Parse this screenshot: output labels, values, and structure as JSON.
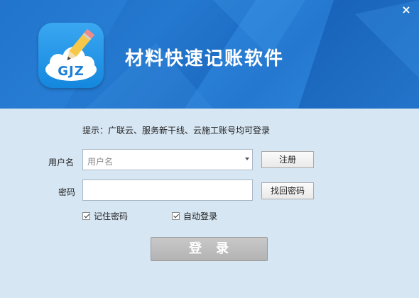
{
  "header": {
    "title": "材料快速记账软件",
    "close_icon": "×",
    "logo_text": "GJZ"
  },
  "form": {
    "tip": "提示：广联云、服务新干线、云施工账号均可登录",
    "username_label": "用户名",
    "username_placeholder": "用户名",
    "password_label": "密码",
    "register_label": "注册",
    "find_password_label": "找回密码",
    "remember_label": "记住密码",
    "auto_login_label": "自动登录",
    "remember_checked": true,
    "auto_login_checked": true,
    "login_label": "登　录"
  },
  "colors": {
    "header_blue": "#2a7fd6",
    "body_bg": "#d7e6f3",
    "login_button_gray": "#bdbdbd"
  }
}
